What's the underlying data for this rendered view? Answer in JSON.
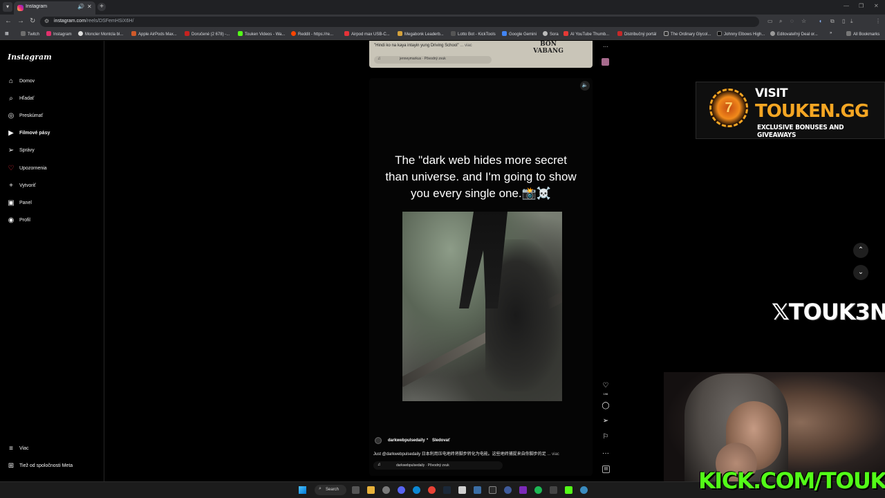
{
  "browser": {
    "tab_title": "Instagram",
    "url_host": "instagram.com",
    "url_path": "/reels/DSFemHSiX6H/",
    "bookmarks": [
      "Twitch",
      "Instagram",
      "Moncler Montcla bl...",
      "Apple AirPods Max...",
      "Doručené (2 678) -...",
      "Touken Videos - Wa...",
      "Reddit - https://re...",
      "Airpod max USB-C...",
      "Megabonk Leaderb...",
      "Lotto Bot - KickTools",
      "Google Gemini",
      "Sora",
      "AI YouTube Thumb...",
      "Distribučný portál",
      "The Ordinary Glycol...",
      "Johnny Elbows High...",
      "Editovateľný Deal or..."
    ],
    "all_bookmarks": "All Bookmarks"
  },
  "sidebar": {
    "logo": "Instagram",
    "items": [
      {
        "label": "Domov",
        "icon": "home-icon"
      },
      {
        "label": "Hľadať",
        "icon": "search-icon"
      },
      {
        "label": "Preskúmať",
        "icon": "compass-icon"
      },
      {
        "label": "Filmové pásy",
        "icon": "reels-icon"
      },
      {
        "label": "Správy",
        "icon": "send-icon"
      },
      {
        "label": "Upozornenia",
        "icon": "heart-icon"
      },
      {
        "label": "Vytvoriť",
        "icon": "plus-icon"
      },
      {
        "label": "Panel",
        "icon": "dashboard-icon"
      },
      {
        "label": "Profil",
        "icon": "profile-icon"
      }
    ],
    "more": "Viac",
    "meta": "Tiež od spoločnosti Meta"
  },
  "previous_reel": {
    "caption": "\"Hindi ko na kaya intayin yung Driving School\"",
    "more": "... viac",
    "audio": "jenneymarkus · Pôvodný zvuk",
    "logo_text": "BON VABANG"
  },
  "reel": {
    "overlay_text": "The \"dark web hides more secret than universe. and I'm going to show you every single one.📸☠️",
    "author": "darkwebpulsedaily",
    "follow": "Sledovať",
    "caption": "Just @darkwebpulsedaily 日本利用压电地砖将脚步转化为电能。这些地砖捕捉来自你脚步的足",
    "caption_more": "... viac",
    "audio": "darkwebpulsedaily · Pôvodný zvuk",
    "like_count": "196"
  },
  "overlays": {
    "promo_visit": "VISIT",
    "promo_site": "TOUKEN.GG",
    "promo_tag": "EXCLUSIVE BONUSES AND GIVEAWAYS",
    "x_handle": "𝕏TOUK3N",
    "kick_url": "KICK.COM/TOUKEN"
  },
  "taskbar": {
    "search": "Search"
  }
}
